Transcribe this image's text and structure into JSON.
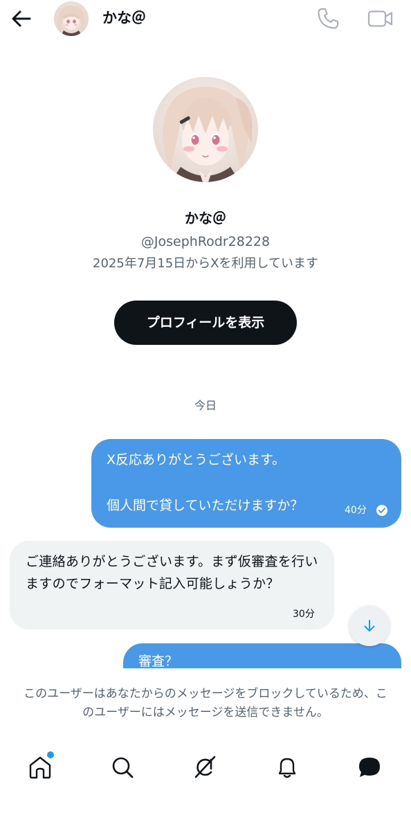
{
  "header": {
    "name": "かな＠",
    "back_icon": "arrow-left-icon",
    "call_icon": "phone-icon",
    "video_icon": "video-camera-icon"
  },
  "profile": {
    "name": "かな＠",
    "handle": "@JosephRodr28228",
    "joined": "2025年7月15日からXを利用しています",
    "view_profile_label": "プロフィールを表示"
  },
  "conversation": {
    "date_separator": "今日",
    "messages": [
      {
        "direction": "outgoing",
        "lines": [
          "X反応ありがとうございます。",
          "個人間で貸していただけますか？"
        ],
        "time": "40分",
        "status_icon": "read-check-icon"
      },
      {
        "direction": "incoming",
        "text": "ご連絡ありがとうございます。まず仮審査を行いますのでフォーマット記入可能しょうか？",
        "time": "30分"
      },
      {
        "direction": "outgoing",
        "lines": [
          "審査？"
        ]
      }
    ],
    "scroll_down_icon": "arrow-down-icon"
  },
  "blocked_notice": "このユーザーはあなたからのメッセージをブロックしているため、このユーザーにはメッセージを送信できません。",
  "bottom_nav": {
    "items": [
      "home-icon",
      "search-icon",
      "grok-icon",
      "bell-icon",
      "messages-icon"
    ],
    "home_has_badge": true
  },
  "colors": {
    "outgoing_bubble": "#4a99e9",
    "incoming_bubble": "#eff3f4",
    "primary_text": "#0f1419",
    "secondary_text": "#536471",
    "badge": "#1d9bf0"
  }
}
